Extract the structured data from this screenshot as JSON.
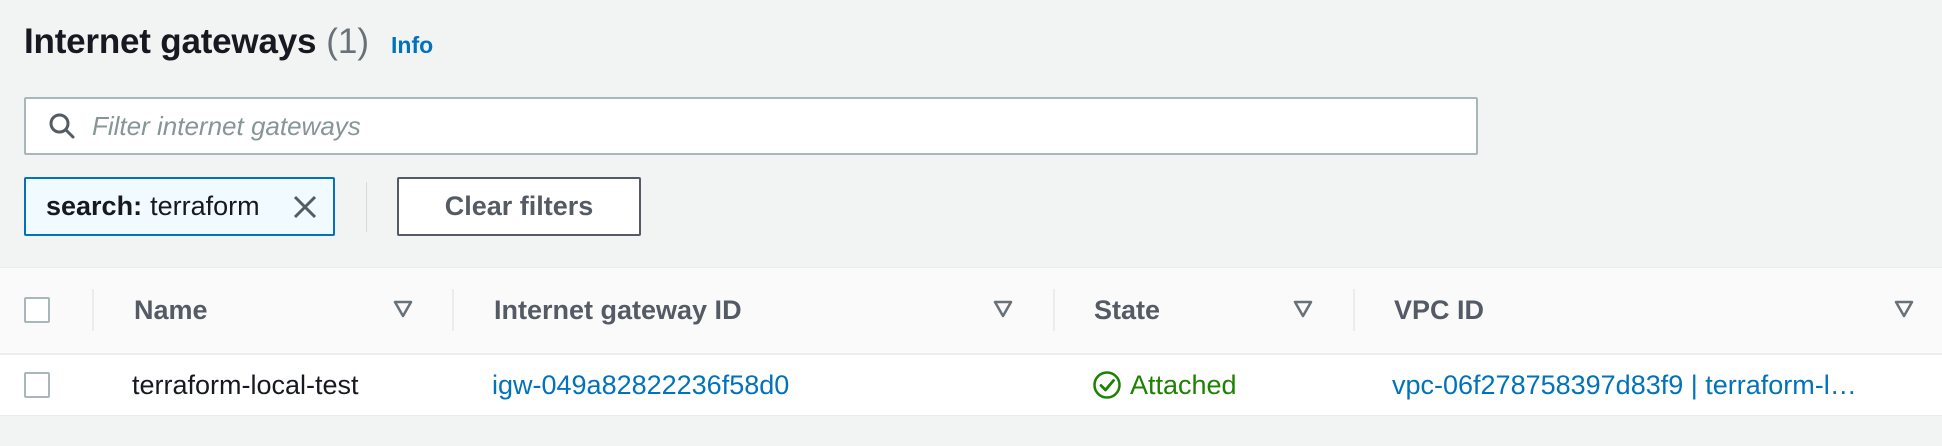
{
  "header": {
    "title": "Internet gateways",
    "count": "(1)",
    "info_label": "Info"
  },
  "search": {
    "placeholder": "Filter internet gateways",
    "value": ""
  },
  "filter_token": {
    "key": "search:",
    "value": "terraform"
  },
  "clear_filters_label": "Clear filters",
  "table": {
    "columns": [
      "Name",
      "Internet gateway ID",
      "State",
      "VPC ID"
    ],
    "rows": [
      {
        "name": "terraform-local-test",
        "igw_id": "igw-049a82822236f58d0",
        "state": "Attached",
        "vpc_id": "vpc-06f278758397d83f9 | terraform-l…"
      }
    ]
  },
  "colors": {
    "link": "#0073bb",
    "success": "#1d8102",
    "muted": "#545b64"
  },
  "icons": [
    "search-icon",
    "close-icon",
    "sort-caret-icon",
    "success-check-icon"
  ]
}
